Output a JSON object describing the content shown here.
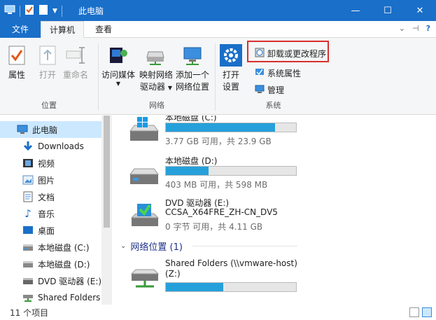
{
  "window": {
    "title": "此电脑",
    "min": "—",
    "max": "☐",
    "close": "✕"
  },
  "tabs": {
    "file": "文件",
    "computer": "计算机",
    "view": "查看"
  },
  "ribbon": {
    "location": {
      "label": "位置",
      "properties": "属性",
      "open": "打开",
      "rename": "重命名"
    },
    "network": {
      "label": "网络",
      "media": "访问媒体",
      "map1": "映射网络",
      "map2": "驱动器",
      "add1": "添加一个",
      "add2": "网络位置"
    },
    "system": {
      "label": "系统",
      "open1": "打开",
      "open2": "设置",
      "uninstall": "卸载或更改程序",
      "sysprops": "系统属性",
      "manage": "管理"
    }
  },
  "nav": {
    "items": [
      {
        "label": "此电脑",
        "icon": "computer-icon",
        "selected": true
      },
      {
        "label": "Downloads",
        "icon": "download-arrow-icon"
      },
      {
        "label": "视频",
        "icon": "video-icon"
      },
      {
        "label": "图片",
        "icon": "picture-icon"
      },
      {
        "label": "文档",
        "icon": "document-icon"
      },
      {
        "label": "音乐",
        "icon": "music-note-icon"
      },
      {
        "label": "桌面",
        "icon": "desktop-icon"
      },
      {
        "label": "本地磁盘 (C:)",
        "icon": "drive-icon"
      },
      {
        "label": "本地磁盘 (D:)",
        "icon": "drive-icon"
      },
      {
        "label": "DVD 驱动器 (E:)",
        "icon": "dvd-icon"
      },
      {
        "label": "Shared Folders",
        "icon": "network-drive-icon"
      }
    ]
  },
  "drives": [
    {
      "name": "本地磁盘 (C:)",
      "detail": "3.77 GB 可用，共 23.9 GB",
      "used_fraction": 0.84
    },
    {
      "name": "本地磁盘 (D:)",
      "detail": "403 MB 可用，共 598 MB",
      "used_fraction": 0.33
    },
    {
      "name": "DVD 驱动器 (E:)",
      "name2": "CCSA_X64FRE_ZH-CN_DV5",
      "detail": "0 字节 可用，共 4.11 GB"
    }
  ],
  "network_section": {
    "title": "网络位置 (1)"
  },
  "network_drive": {
    "name": "Shared Folders (\\\\vmware-host)",
    "name2": "(Z:)",
    "used_fraction": 0.44
  },
  "status": {
    "count": "11 个项目"
  },
  "colors": {
    "accent": "#1a6fc9",
    "bar_fill": "#26a0da",
    "highlight": "#d92f2f"
  }
}
